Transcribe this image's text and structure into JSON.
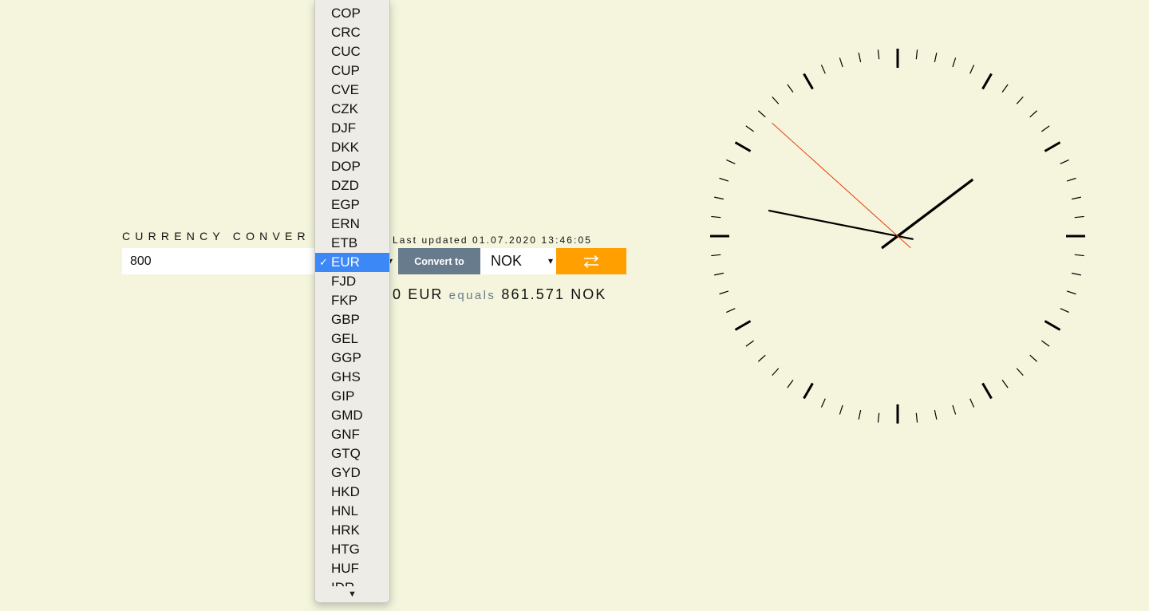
{
  "converter": {
    "title": "CURRENCY CONVER",
    "amount_value": "800",
    "from_currency": "EUR",
    "convert_label": "Convert to",
    "to_currency": "NOK",
    "last_updated": "Last updated 01.07.2020 13:46:05",
    "result": {
      "from_text": "0 EUR",
      "equals_word": "equals",
      "to_text": "861.571 NOK"
    }
  },
  "dropdown": {
    "options": [
      "COP",
      "CRC",
      "CUC",
      "CUP",
      "CVE",
      "CZK",
      "DJF",
      "DKK",
      "DOP",
      "DZD",
      "EGP",
      "ERN",
      "ETB",
      "EUR",
      "FJD",
      "FKP",
      "GBP",
      "GEL",
      "GGP",
      "GHS",
      "GIP",
      "GMD",
      "GNF",
      "GTQ",
      "GYD",
      "HKD",
      "HNL",
      "HRK",
      "HTG",
      "HUF",
      "IDR"
    ],
    "selected": "EUR",
    "check_mark": "✓",
    "scroll_arrow": "▼"
  },
  "icons": {
    "chevron": "chevron-down-icon",
    "swap": "swap-arrows-icon",
    "check": "checkmark-icon",
    "scroll": "scroll-down-arrow-icon"
  },
  "clock": {
    "hours": 1,
    "minutes": 46,
    "seconds": 52,
    "hand_color": "#000000",
    "second_hand_color": "#e8380d"
  },
  "colors": {
    "background": "#f4f5dc",
    "convert_button": "#677b8c",
    "swap_button": "#ffa000",
    "selected_option": "#3d88f7"
  }
}
